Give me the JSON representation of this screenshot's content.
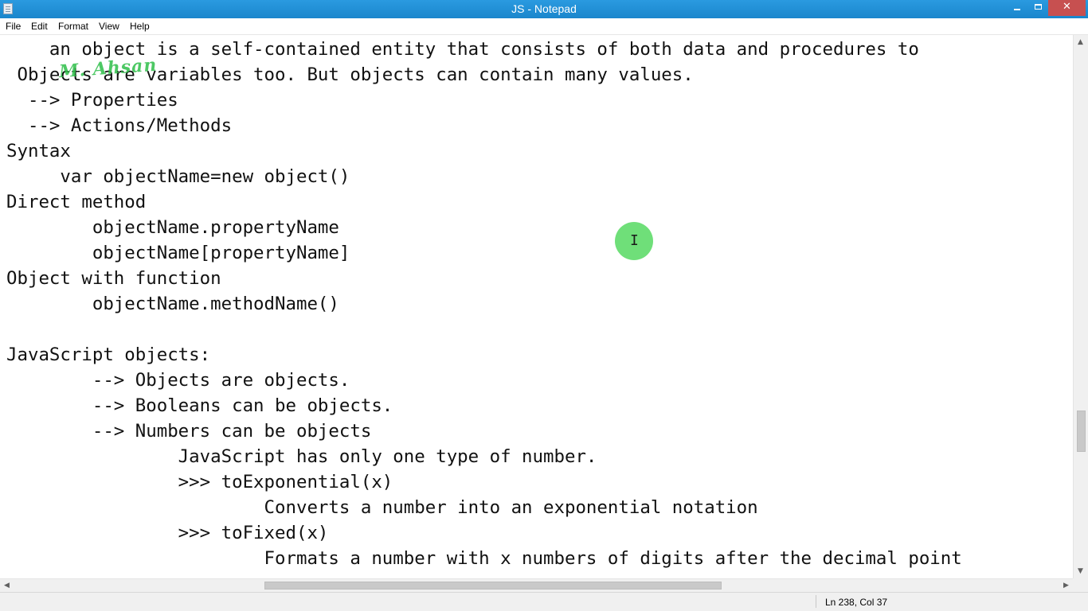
{
  "window": {
    "title": "JS - Notepad",
    "minimize_glyph": "minimize-icon",
    "maximize_glyph": "restore-icon",
    "close_label": "✕"
  },
  "menu": {
    "items": [
      "File",
      "Edit",
      "Format",
      "View",
      "Help"
    ]
  },
  "editor": {
    "watermark": "M. Ahsan",
    "lines": [
      "    an object is a self-contained entity that consists of both data and procedures to",
      " Objects are variables too. But objects can contain many values.",
      "  --> Properties",
      "  --> Actions/Methods",
      "Syntax",
      "     var objectName=new object()",
      "Direct method",
      "        objectName.propertyName",
      "        objectName[propertyName]",
      "Object with function",
      "        objectName.methodName()",
      "",
      "JavaScript objects:",
      "        --> Objects are objects.",
      "        --> Booleans can be objects.",
      "        --> Numbers can be objects",
      "                JavaScript has only one type of number.",
      "                >>> toExponential(x)",
      "                        Converts a number into an exponential notation",
      "                >>> toFixed(x)",
      "                        Formats a number with x numbers of digits after the decimal point"
    ],
    "cursor_glyph": "I"
  },
  "scrollbars": {
    "up_arrow": "▲",
    "down_arrow": "▼",
    "left_arrow": "◀",
    "right_arrow": "▶",
    "vertical_position": 0.79,
    "horizontal_position": 0.25
  },
  "status": {
    "position": "Ln 238, Col 37"
  },
  "colors": {
    "titlebar": "#1a86cc",
    "close_button": "#c75050",
    "watermark": "#2fbf4a",
    "cursor_highlight": "#5fdc6a"
  }
}
